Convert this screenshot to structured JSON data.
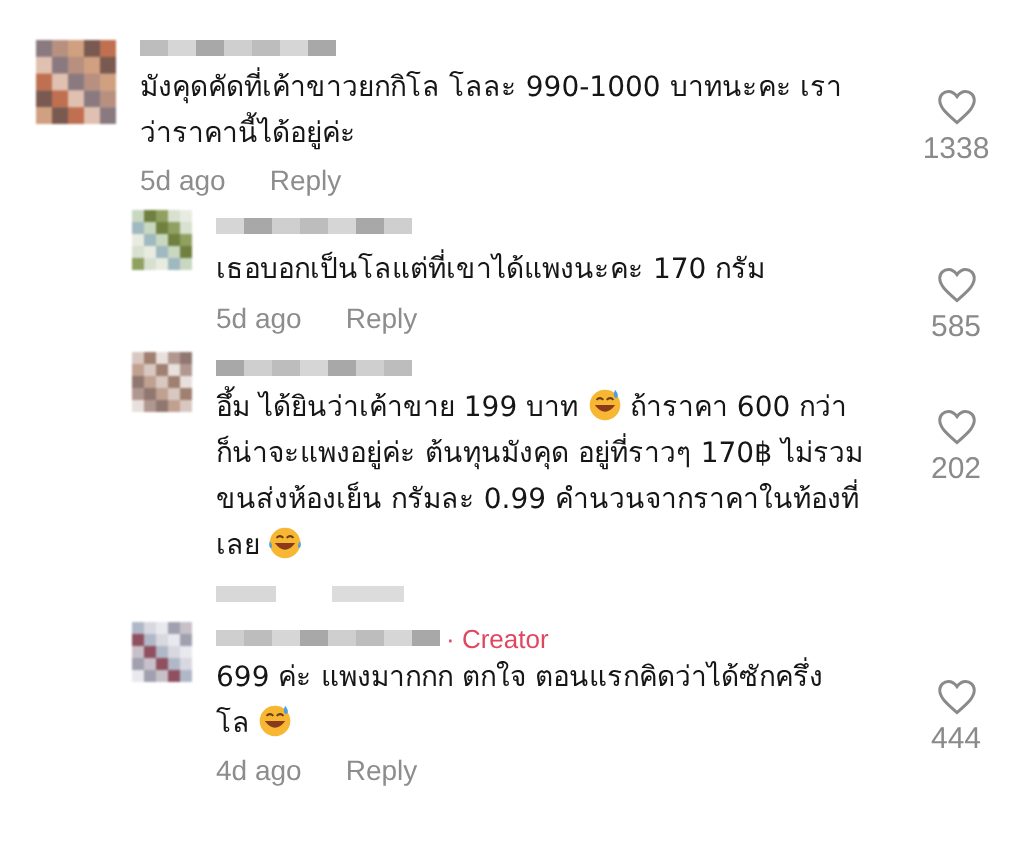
{
  "comments": [
    {
      "kind": "comment",
      "lines": [
        [
          {
            "kind": "text",
            "text": "มังคุดคัดที่เค้าขาวยกกิโล โลละ 990-1000 บาทนะคะ เรา"
          }
        ],
        [
          {
            "kind": "text",
            "text": "ว่าราคานี้ได้อยู่ค่ะ"
          }
        ]
      ],
      "time": "5d ago",
      "reply": "Reply",
      "likes": "1338"
    },
    {
      "kind": "reply",
      "lines": [
        [
          {
            "kind": "text",
            "text": "เธอบอกเป็นโลแต่ที่เขาได้แพงนะคะ 170 กรัม"
          }
        ]
      ],
      "time": "5d ago",
      "reply": "Reply",
      "likes": "585"
    },
    {
      "kind": "reply",
      "lines": [
        [
          {
            "kind": "text",
            "text": "อึ้ม ได้ยินว่าเค้าขาย 199 บาท "
          },
          {
            "kind": "grin"
          },
          {
            "kind": "text",
            "text": " ถ้าราคา 600 กว่า"
          }
        ],
        [
          {
            "kind": "text",
            "text": "ก็น่าจะแพงอยู่ค่ะ ต้นทุนมังคุด อยู่ที่ราวๆ 170฿ ไม่รวม"
          }
        ],
        [
          {
            "kind": "text",
            "text": "ขนส่งห้องเย็น กรัมละ 0.99 คำนวนจากราคาในท้องที่"
          }
        ],
        [
          {
            "kind": "text",
            "text": "เลย "
          },
          {
            "kind": "laugh"
          }
        ]
      ],
      "likes": "202"
    },
    {
      "kind": "reply",
      "badge": "· Creator",
      "lines": [
        [
          {
            "kind": "text",
            "text": "699 ค่ะ แพงมากกก ตกใจ ตอนแรกคิดว่าได้ซักครึ่ง"
          }
        ],
        [
          {
            "kind": "text",
            "text": "โล "
          },
          {
            "kind": "grin"
          }
        ]
      ],
      "time": "4d ago",
      "reply": "Reply",
      "likes": "444"
    }
  ]
}
